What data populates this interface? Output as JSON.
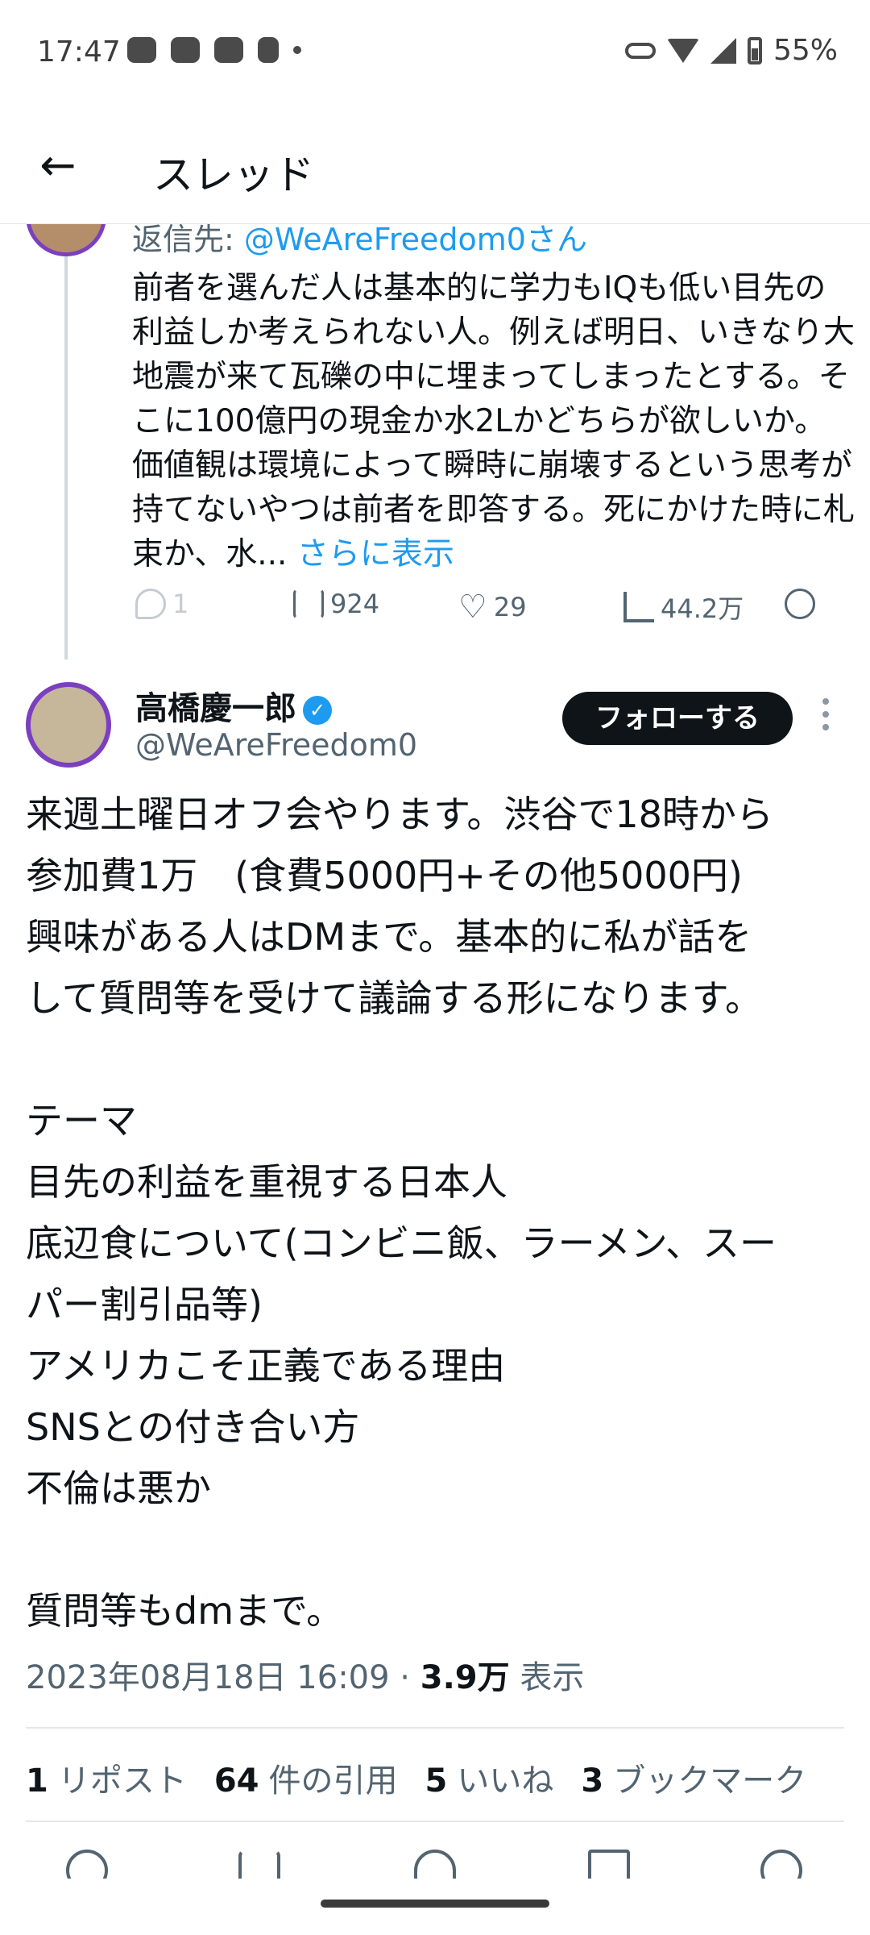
{
  "status_bar": {
    "time": "17:47",
    "battery": "55%"
  },
  "header": {
    "back_icon": "arrow-left",
    "title": "スレッド"
  },
  "parent_tweet": {
    "reply_to_prefix": "返信先: ",
    "reply_to_handle": "@WeAreFreedom0さん",
    "text": "前者を選んだ人は基本的に学力もIQも低い目先の利益しか考えられない人。例えば明日、いきなり大地震が来て瓦礫の中に埋まってしまったとする。そこに100億円の現金か水2Lかどちらが欲しいか。価値観は環境によって瞬時に崩壊するという思考が持てないやつは前者を即答する。死にかけた時に札束か、水...",
    "more_label": "さらに表示",
    "replies": "1",
    "retweets": "924",
    "likes": "29",
    "views": "44.2万"
  },
  "author": {
    "name": "高橋慶一郎",
    "handle": "@WeAreFreedom0",
    "follow_label": "フォローする"
  },
  "tweet": {
    "lines": [
      "来週土曜日オフ会やります。渋谷で18時から",
      "参加費1万　(食費5000円+その他5000円)",
      "興味がある人はDMまで。基本的に私が話を",
      "して質問等を受けて議論する形になります。",
      "",
      "テーマ",
      "目先の利益を重視する日本人",
      "底辺食について(コンビニ飯、ラーメン、スー",
      "パー割引品等)",
      "アメリカこそ正義である理由",
      "SNSとの付き合い方",
      "不倫は悪か",
      "",
      "質問等もdmまで。"
    ],
    "timestamp": "2023年08月18日 16:09",
    "view_count": "3.9万",
    "view_label": "表示"
  },
  "stats": {
    "reposts_count": "1",
    "reposts_label": "リポスト",
    "quotes_count": "64",
    "quotes_label": "件の引用",
    "likes_count": "5",
    "likes_label": "いいね",
    "bookmarks_count": "3",
    "bookmarks_label": "ブックマーク"
  },
  "colors": {
    "accent": "#1d9bf0",
    "avatar_ring": "#7b3fbf",
    "text": "#0f1419",
    "muted": "#536471"
  }
}
